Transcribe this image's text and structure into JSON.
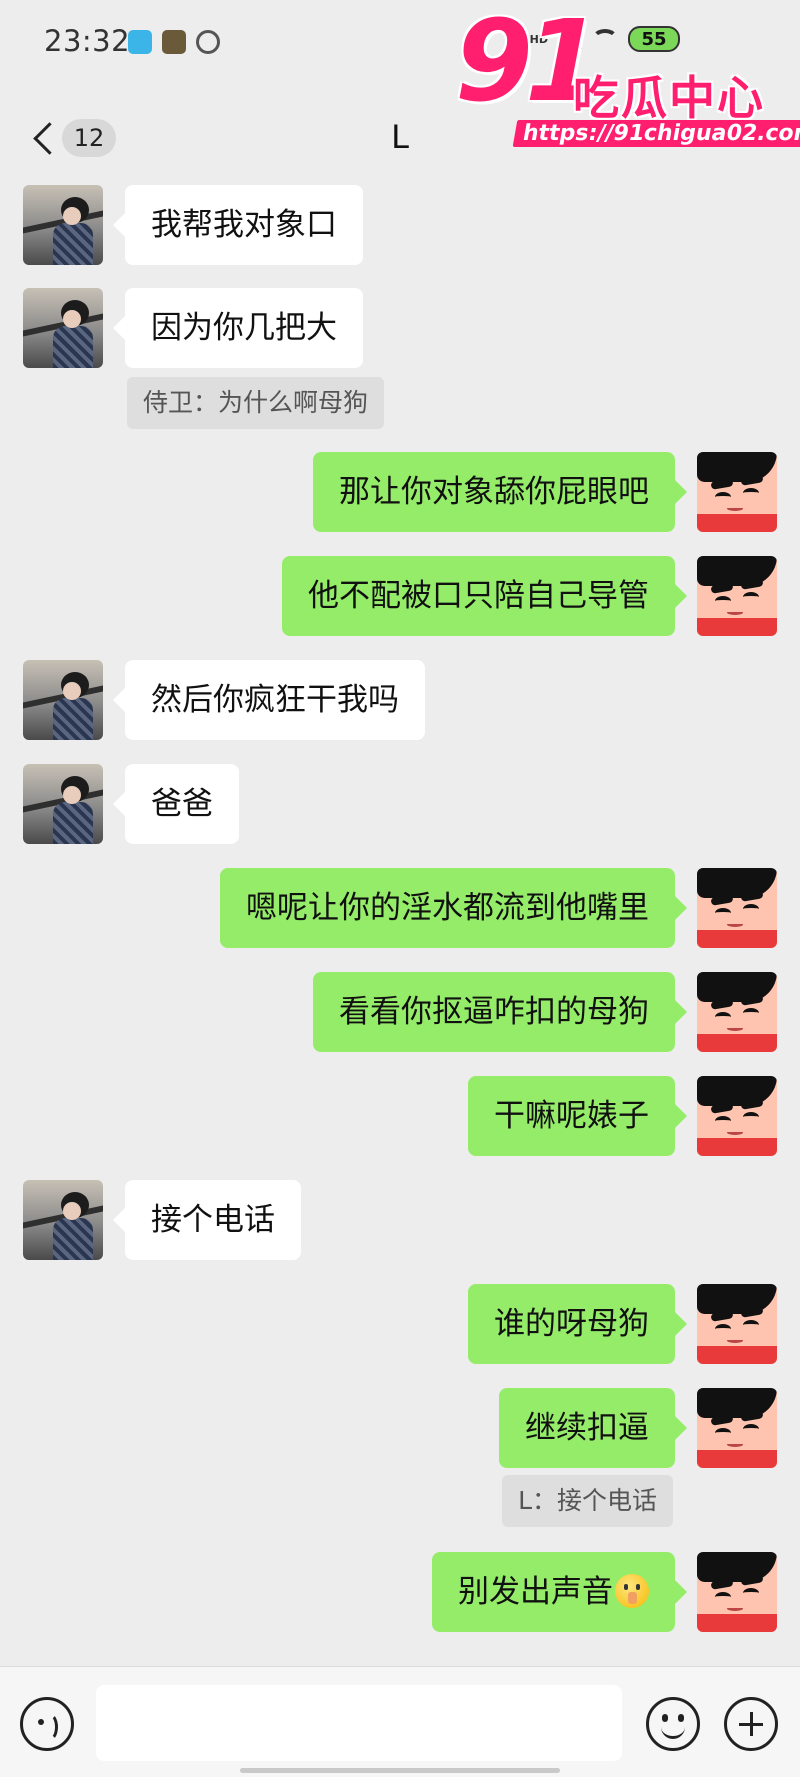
{
  "status_bar": {
    "time": "23:32",
    "network": "4G HD",
    "battery": "55",
    "battery_color": "#7bd858"
  },
  "watermark": {
    "big": "91",
    "text": "吃瓜中心",
    "url": "https://91chigua02.com",
    "color": "#ff1f6e"
  },
  "nav": {
    "back_icon": "chevron-left-icon",
    "unread_count": "12",
    "title": "L"
  },
  "colors": {
    "background": "#ededed",
    "bubble_self": "#95ec69",
    "bubble_other": "#ffffff"
  },
  "messages": [
    {
      "side": "left",
      "text": "我帮我对象口"
    },
    {
      "side": "left",
      "text": "因为你几把大"
    },
    {
      "side": "quote-left",
      "text": "侍卫：为什么啊母狗"
    },
    {
      "side": "right",
      "text": "那让你对象舔你屁眼吧"
    },
    {
      "side": "right",
      "text": "他不配被口只陪自己导管"
    },
    {
      "side": "left",
      "text": "然后你疯狂干我吗"
    },
    {
      "side": "left",
      "text": "爸爸"
    },
    {
      "side": "right",
      "text": "嗯呢让你的淫水都流到他嘴里"
    },
    {
      "side": "right",
      "text": "看看你抠逼咋扣的母狗"
    },
    {
      "side": "right",
      "text": "干嘛呢婊子"
    },
    {
      "side": "left",
      "text": "接个电话"
    },
    {
      "side": "right",
      "text": "谁的呀母狗"
    },
    {
      "side": "right",
      "text": "继续扣逼"
    },
    {
      "side": "quote-right",
      "text": "L：接个电话"
    },
    {
      "side": "right",
      "text": "别发出声音",
      "emoji": "shushing-face-icon"
    }
  ],
  "input_bar": {
    "voice_icon": "voice-icon",
    "emoji_icon": "emoji-icon",
    "plus_icon": "plus-icon",
    "value": ""
  }
}
